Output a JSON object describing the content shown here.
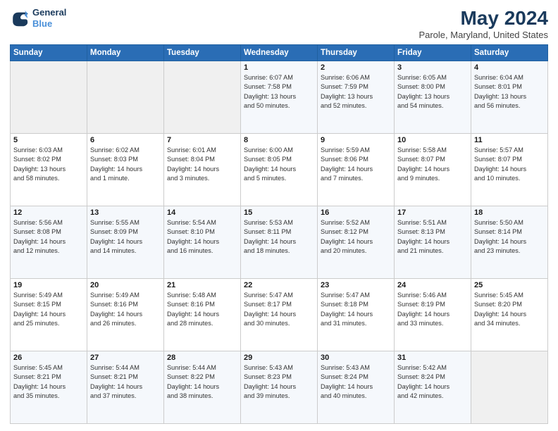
{
  "header": {
    "logo_line1": "General",
    "logo_line2": "Blue",
    "title": "May 2024",
    "subtitle": "Parole, Maryland, United States"
  },
  "days_of_week": [
    "Sunday",
    "Monday",
    "Tuesday",
    "Wednesday",
    "Thursday",
    "Friday",
    "Saturday"
  ],
  "weeks": [
    [
      {
        "day": "",
        "info": ""
      },
      {
        "day": "",
        "info": ""
      },
      {
        "day": "",
        "info": ""
      },
      {
        "day": "1",
        "info": "Sunrise: 6:07 AM\nSunset: 7:58 PM\nDaylight: 13 hours\nand 50 minutes."
      },
      {
        "day": "2",
        "info": "Sunrise: 6:06 AM\nSunset: 7:59 PM\nDaylight: 13 hours\nand 52 minutes."
      },
      {
        "day": "3",
        "info": "Sunrise: 6:05 AM\nSunset: 8:00 PM\nDaylight: 13 hours\nand 54 minutes."
      },
      {
        "day": "4",
        "info": "Sunrise: 6:04 AM\nSunset: 8:01 PM\nDaylight: 13 hours\nand 56 minutes."
      }
    ],
    [
      {
        "day": "5",
        "info": "Sunrise: 6:03 AM\nSunset: 8:02 PM\nDaylight: 13 hours\nand 58 minutes."
      },
      {
        "day": "6",
        "info": "Sunrise: 6:02 AM\nSunset: 8:03 PM\nDaylight: 14 hours\nand 1 minute."
      },
      {
        "day": "7",
        "info": "Sunrise: 6:01 AM\nSunset: 8:04 PM\nDaylight: 14 hours\nand 3 minutes."
      },
      {
        "day": "8",
        "info": "Sunrise: 6:00 AM\nSunset: 8:05 PM\nDaylight: 14 hours\nand 5 minutes."
      },
      {
        "day": "9",
        "info": "Sunrise: 5:59 AM\nSunset: 8:06 PM\nDaylight: 14 hours\nand 7 minutes."
      },
      {
        "day": "10",
        "info": "Sunrise: 5:58 AM\nSunset: 8:07 PM\nDaylight: 14 hours\nand 9 minutes."
      },
      {
        "day": "11",
        "info": "Sunrise: 5:57 AM\nSunset: 8:07 PM\nDaylight: 14 hours\nand 10 minutes."
      }
    ],
    [
      {
        "day": "12",
        "info": "Sunrise: 5:56 AM\nSunset: 8:08 PM\nDaylight: 14 hours\nand 12 minutes."
      },
      {
        "day": "13",
        "info": "Sunrise: 5:55 AM\nSunset: 8:09 PM\nDaylight: 14 hours\nand 14 minutes."
      },
      {
        "day": "14",
        "info": "Sunrise: 5:54 AM\nSunset: 8:10 PM\nDaylight: 14 hours\nand 16 minutes."
      },
      {
        "day": "15",
        "info": "Sunrise: 5:53 AM\nSunset: 8:11 PM\nDaylight: 14 hours\nand 18 minutes."
      },
      {
        "day": "16",
        "info": "Sunrise: 5:52 AM\nSunset: 8:12 PM\nDaylight: 14 hours\nand 20 minutes."
      },
      {
        "day": "17",
        "info": "Sunrise: 5:51 AM\nSunset: 8:13 PM\nDaylight: 14 hours\nand 21 minutes."
      },
      {
        "day": "18",
        "info": "Sunrise: 5:50 AM\nSunset: 8:14 PM\nDaylight: 14 hours\nand 23 minutes."
      }
    ],
    [
      {
        "day": "19",
        "info": "Sunrise: 5:49 AM\nSunset: 8:15 PM\nDaylight: 14 hours\nand 25 minutes."
      },
      {
        "day": "20",
        "info": "Sunrise: 5:49 AM\nSunset: 8:16 PM\nDaylight: 14 hours\nand 26 minutes."
      },
      {
        "day": "21",
        "info": "Sunrise: 5:48 AM\nSunset: 8:16 PM\nDaylight: 14 hours\nand 28 minutes."
      },
      {
        "day": "22",
        "info": "Sunrise: 5:47 AM\nSunset: 8:17 PM\nDaylight: 14 hours\nand 30 minutes."
      },
      {
        "day": "23",
        "info": "Sunrise: 5:47 AM\nSunset: 8:18 PM\nDaylight: 14 hours\nand 31 minutes."
      },
      {
        "day": "24",
        "info": "Sunrise: 5:46 AM\nSunset: 8:19 PM\nDaylight: 14 hours\nand 33 minutes."
      },
      {
        "day": "25",
        "info": "Sunrise: 5:45 AM\nSunset: 8:20 PM\nDaylight: 14 hours\nand 34 minutes."
      }
    ],
    [
      {
        "day": "26",
        "info": "Sunrise: 5:45 AM\nSunset: 8:21 PM\nDaylight: 14 hours\nand 35 minutes."
      },
      {
        "day": "27",
        "info": "Sunrise: 5:44 AM\nSunset: 8:21 PM\nDaylight: 14 hours\nand 37 minutes."
      },
      {
        "day": "28",
        "info": "Sunrise: 5:44 AM\nSunset: 8:22 PM\nDaylight: 14 hours\nand 38 minutes."
      },
      {
        "day": "29",
        "info": "Sunrise: 5:43 AM\nSunset: 8:23 PM\nDaylight: 14 hours\nand 39 minutes."
      },
      {
        "day": "30",
        "info": "Sunrise: 5:43 AM\nSunset: 8:24 PM\nDaylight: 14 hours\nand 40 minutes."
      },
      {
        "day": "31",
        "info": "Sunrise: 5:42 AM\nSunset: 8:24 PM\nDaylight: 14 hours\nand 42 minutes."
      },
      {
        "day": "",
        "info": ""
      }
    ]
  ]
}
